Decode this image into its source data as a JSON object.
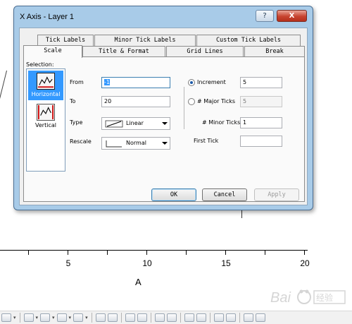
{
  "plot": {
    "tick_labels": [
      "5",
      "10",
      "15",
      "20"
    ],
    "axis_title": "A"
  },
  "dialog": {
    "title": "X Axis - Layer 1",
    "help_glyph": "?",
    "close_glyph": "X",
    "tabs_back_row": [
      "Tick Labels",
      "Minor Tick Labels",
      "Custom Tick Labels"
    ],
    "tabs_front_row": [
      "Scale",
      "Title & Format",
      "Grid Lines",
      "Break"
    ],
    "active_tab": "Scale",
    "selection": {
      "caption": "Selection:",
      "items": [
        {
          "label": "Horizontal",
          "selected": true
        },
        {
          "label": "Vertical",
          "selected": false
        }
      ]
    },
    "from": {
      "label": "From",
      "value": "-1"
    },
    "to": {
      "label": "To",
      "value": "20"
    },
    "type": {
      "label": "Type",
      "value": "Linear"
    },
    "rescale": {
      "label": "Rescale",
      "value": "Normal"
    },
    "increment": {
      "label": "Increment",
      "value": "5",
      "selected": true
    },
    "major_ticks": {
      "label": "# Major Ticks",
      "value": "5",
      "selected": false
    },
    "minor_ticks": {
      "label": "# Minor Ticks",
      "value": "1"
    },
    "first_tick": {
      "label": "First Tick",
      "value": ""
    },
    "buttons": {
      "ok": "OK",
      "cancel": "Cancel",
      "apply": "Apply"
    }
  },
  "watermark": {
    "text": "Bai 经验"
  },
  "colors": {
    "selection": "#3399ff",
    "dialog_frame": "#a8cbe8",
    "close_button": "#c7432f"
  }
}
